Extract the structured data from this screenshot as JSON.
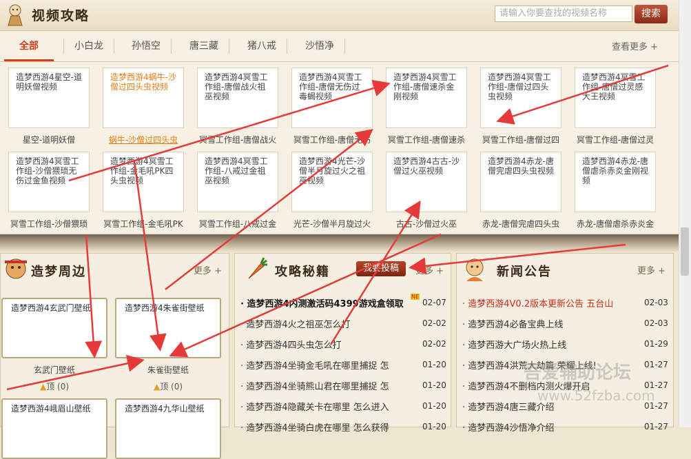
{
  "header": {
    "title": "视频攻略",
    "search_placeholder": "请输入你要查找的视频名称",
    "search_button": "搜索"
  },
  "tabs": [
    {
      "label": "全部"
    },
    {
      "label": "小白龙"
    },
    {
      "label": "孙悟空"
    },
    {
      "label": "唐三藏"
    },
    {
      "label": "猪八戒"
    },
    {
      "label": "沙悟净"
    }
  ],
  "more_top": "查看更多 +",
  "videos_row1": [
    {
      "thumb": "造梦西游4星空-道明妖僧视频",
      "caption": "星空-道明妖僧"
    },
    {
      "thumb": "造梦西游4蜗牛-沙僧过四头虫视频",
      "caption": "蜗牛-沙僧过四头虫"
    },
    {
      "thumb": "造梦西游4冥雪工作组-唐僧战火祖巫视频",
      "caption": "冥雪工作组-唐僧战火"
    },
    {
      "thumb": "造梦西游4冥雪工作组-唐僧无伤过毒蝎视频",
      "caption": "冥雪工作组-唐僧无伤"
    },
    {
      "thumb": "造梦西游4冥雪工作组-唐僧速杀金刚视频",
      "caption": "冥雪工作组-唐僧速杀"
    },
    {
      "thumb": "造梦西游4冥雪工作组-唐僧过四头虫视频",
      "caption": "冥雪工作组-唐僧过四"
    },
    {
      "thumb": "造梦西游4冥雪工作组-唐僧过灵感大王视频",
      "caption": "冥雪工作组-唐僧过灵"
    }
  ],
  "videos_row2": [
    {
      "thumb": "造梦西游4冥雪工作组-沙僧猥琐无伤过金鱼视频",
      "caption": "冥雪工作组-沙僧猥琐"
    },
    {
      "thumb": "造梦西游4冥雪工作组-金毛吼PK四头虫视频",
      "caption": "冥雪工作组-金毛吼PK"
    },
    {
      "thumb": "造梦西游4冥雪工作组-八戒过金祖巫视频",
      "caption": "冥雪工作组-八戒过金"
    },
    {
      "thumb": "造梦西游4光芒-沙僧半月旋过火之祖巫视频",
      "caption": "光芒-沙僧半月旋过火"
    },
    {
      "thumb": "造梦西游4古古-沙僧过火巫视频",
      "caption": "古古-沙僧过火巫"
    },
    {
      "thumb": "造梦西游4赤龙-唐僧完虐四头虫视频",
      "caption": "赤龙-唐僧完虐四头虫"
    },
    {
      "thumb": "造梦西游4赤龙-唐僧虐杀赤炎金刚视频",
      "caption": "赤龙-唐僧虐杀赤炎金"
    }
  ],
  "zhoubian": {
    "title": "造梦周边",
    "more": "更多 +",
    "items": [
      {
        "thumb": "造梦西游4玄武门壁纸",
        "caption": "玄武门壁纸",
        "likes": "顶 (0)"
      },
      {
        "thumb": "造梦西游4朱雀街壁纸",
        "caption": "朱雀街壁纸",
        "likes": "顶 (0)"
      },
      {
        "thumb": "造梦西游4峨眉山壁纸",
        "caption": "",
        "likes": ""
      },
      {
        "thumb": "造梦西游4九华山壁纸",
        "caption": "",
        "likes": ""
      }
    ]
  },
  "miji": {
    "title": "攻略秘籍",
    "submit": "我要投稿",
    "more": "更多 +",
    "items": [
      {
        "text": "造梦西游4内测激活码4399游戏盒领取",
        "date": "02-07",
        "badge": "NE"
      },
      {
        "text": "造梦西游4火之祖巫怎么打",
        "date": "02-02"
      },
      {
        "text": "造梦西游4四头虫怎么打",
        "date": "02-02"
      },
      {
        "text": "造梦西游4坐骑金毛吼在哪里捕捉 怎",
        "date": "01-20"
      },
      {
        "text": "造梦西游4坐骑熊山君在哪里捕捉 怎",
        "date": "01-20"
      },
      {
        "text": "造梦西游4隐藏关卡在哪里 怎么进入",
        "date": "01-20"
      },
      {
        "text": "造梦西游4坐骑白虎在哪里 怎么获得",
        "date": "01-20"
      }
    ]
  },
  "news": {
    "title": "新闻公告",
    "more": "更多 +",
    "items": [
      {
        "text": "造梦西游4V0.2版本更新公告 五台山",
        "date": "02-03",
        "color": "#d0281a"
      },
      {
        "text": "造梦西游4必备宝典上线",
        "date": "02-03"
      },
      {
        "text": "造梦西游大广场火热上线",
        "date": "01-29"
      },
      {
        "text": "造梦西游4洪荒大劫篇 荣耀上线!",
        "date": "01-27"
      },
      {
        "text": "造梦西游4不删档内测火爆开启",
        "date": "01-27"
      },
      {
        "text": "造梦西游4唐三藏介绍",
        "date": "01-27"
      },
      {
        "text": "造梦西游4沙悟净介绍",
        "date": "01-27"
      }
    ]
  },
  "watermark": "吾爱辅助论坛",
  "watermark2": "www.52fzba.com",
  "status_url": "http://www.4399.com/...",
  "colors": {
    "accent": "#d2401c",
    "arrow": "#e63a3a",
    "link_orange": "#e87a12"
  }
}
